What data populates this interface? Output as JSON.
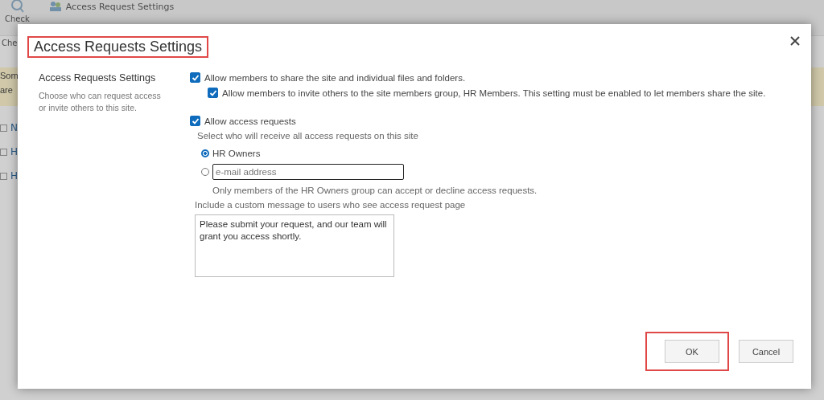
{
  "background": {
    "ribbon": [
      {
        "label": "Check",
        "kind": "big"
      },
      {
        "label": "Access Request Settings",
        "kind": "link"
      }
    ],
    "group_label": "Che",
    "banner": [
      "Som",
      "are"
    ],
    "list_items": [
      {
        "label": "N",
        "checked": false
      },
      {
        "label": "H",
        "checked": false
      },
      {
        "label": "H",
        "checked": false
      }
    ]
  },
  "dialog": {
    "title": "Access Requests Settings",
    "title_highlighted": true,
    "section": {
      "heading": "Access Requests Settings",
      "description": "Choose who can request access or invite others to this site."
    },
    "options": [
      {
        "label": "Allow members to share the site and individual files and folders.",
        "checked": true,
        "children": [
          {
            "label": "Allow members to invite others to the site members group, HR Members. This setting must be enabled to let members share the site.",
            "checked": true
          }
        ]
      },
      {
        "label": "Allow access requests",
        "checked": true
      }
    ],
    "recipients_label": "Select who will receive all access requests on this site",
    "recipients": [
      {
        "label": "HR Owners",
        "selected": true,
        "kind": "label"
      },
      {
        "placeholder": "e-mail address",
        "selected": false,
        "kind": "field"
      }
    ],
    "recipients_note": "Only members of the HR Owners group can accept or decline access requests.",
    "message_label": "Include a custom message to users who see access request page",
    "message": "Please submit your request, and our team will grant you access shortly.",
    "buttons": [
      {
        "label": "OK",
        "highlighted": true
      },
      {
        "label": "Cancel",
        "highlighted": false
      }
    ]
  }
}
